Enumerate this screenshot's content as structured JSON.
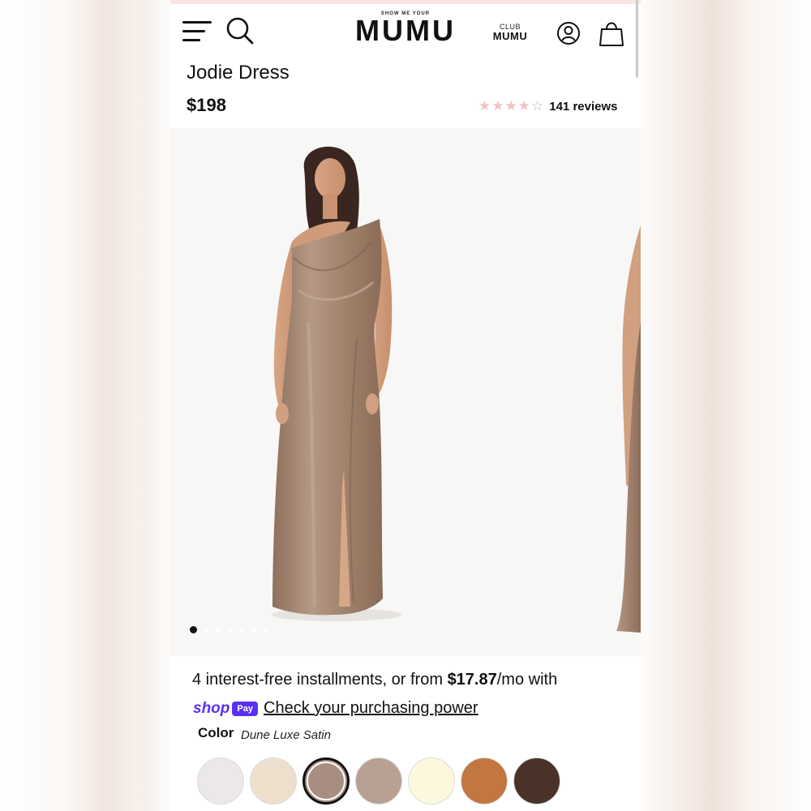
{
  "header": {
    "logo_small": "SHOW ME YOUR",
    "logo_big": "MUMU",
    "club_small": "CLUB",
    "club_big": "MUMU",
    "icons": [
      "menu-icon",
      "search-icon",
      "account-icon",
      "shopping-bag-icon"
    ]
  },
  "product": {
    "title": "Jodie Dress",
    "price": "$198",
    "rating": 4,
    "rating_max": 5,
    "reviews": "141 reviews"
  },
  "gallery": {
    "slide_count": 7,
    "active_index": 0
  },
  "payment": {
    "prefix": "4 interest-free installments, or from ",
    "amount": "$17.87",
    "suffix": "/mo with",
    "shop_word": "shop",
    "pay_badge": "Pay",
    "link": "Check your purchasing power"
  },
  "color": {
    "label": "Color",
    "value": "Dune Luxe Satin",
    "swatches": [
      "#ece8e9",
      "#eedfcd",
      "#a88e80",
      "#b9a094",
      "#fcf8de",
      "#c1773f",
      "#4b3229"
    ],
    "selected_index": 2
  },
  "colors": {
    "shop_pay": "#5a31f4",
    "star_fill": "#f0c3c0",
    "dress": "#a98b76"
  }
}
